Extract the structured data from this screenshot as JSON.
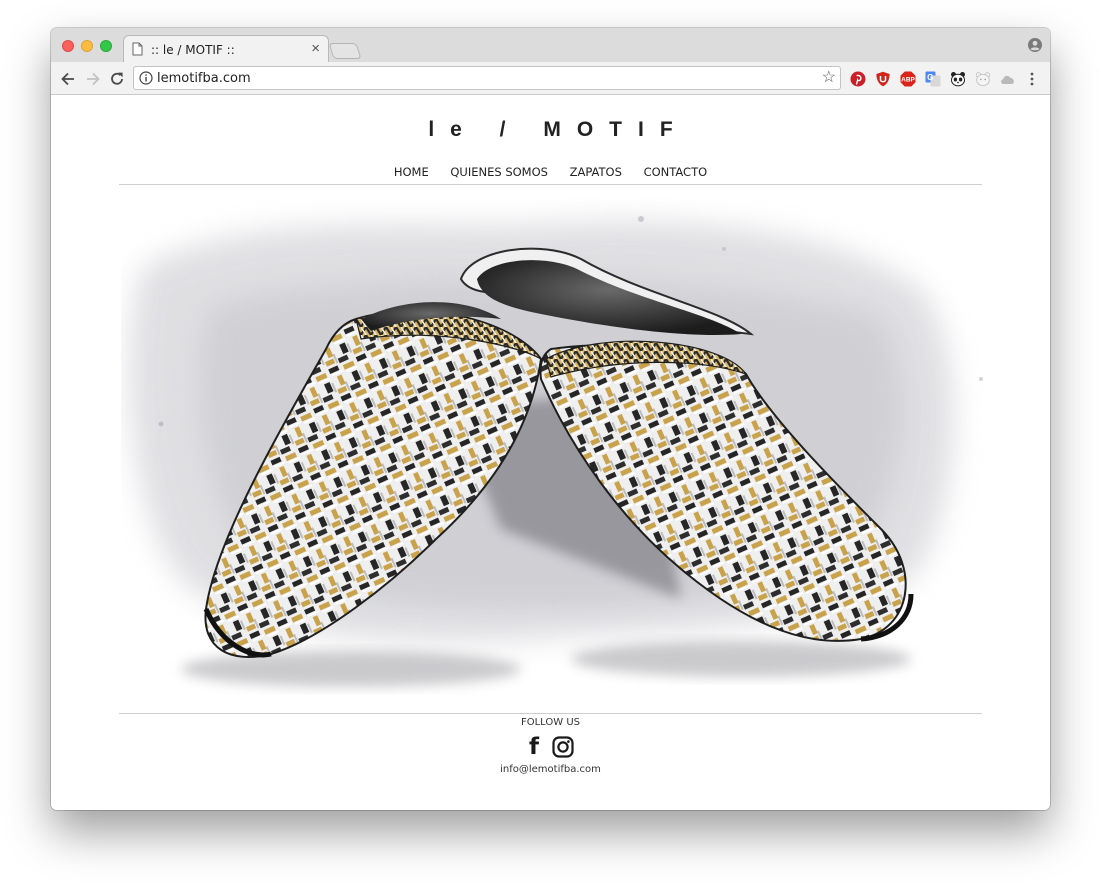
{
  "browser": {
    "tab_title": ":: le / MOTIF ::",
    "close_glyph": "×",
    "url": "lemotifba.com",
    "star_glyph": "☆",
    "extensions": [
      "pinterest-icon",
      "ublock-icon",
      "adblock-plus-icon",
      "google-translate-icon",
      "panda-icon",
      "bear-icon",
      "cloud-icon"
    ],
    "colors": {
      "close": "#fc605c",
      "minimize": "#fdbc40",
      "zoom": "#34c84a"
    }
  },
  "site": {
    "brand": "le / MOTIF",
    "nav": [
      "HOME",
      "QUIENES SOMOS",
      "ZAPATOS",
      "CONTACTO"
    ],
    "hero_image": "woven-slippers-illustration",
    "footer": {
      "follow_label": "FOLLOW US",
      "social": [
        "facebook-icon",
        "instagram-icon"
      ],
      "facebook_glyph": "f",
      "email": "info@lemotifba.com"
    }
  }
}
